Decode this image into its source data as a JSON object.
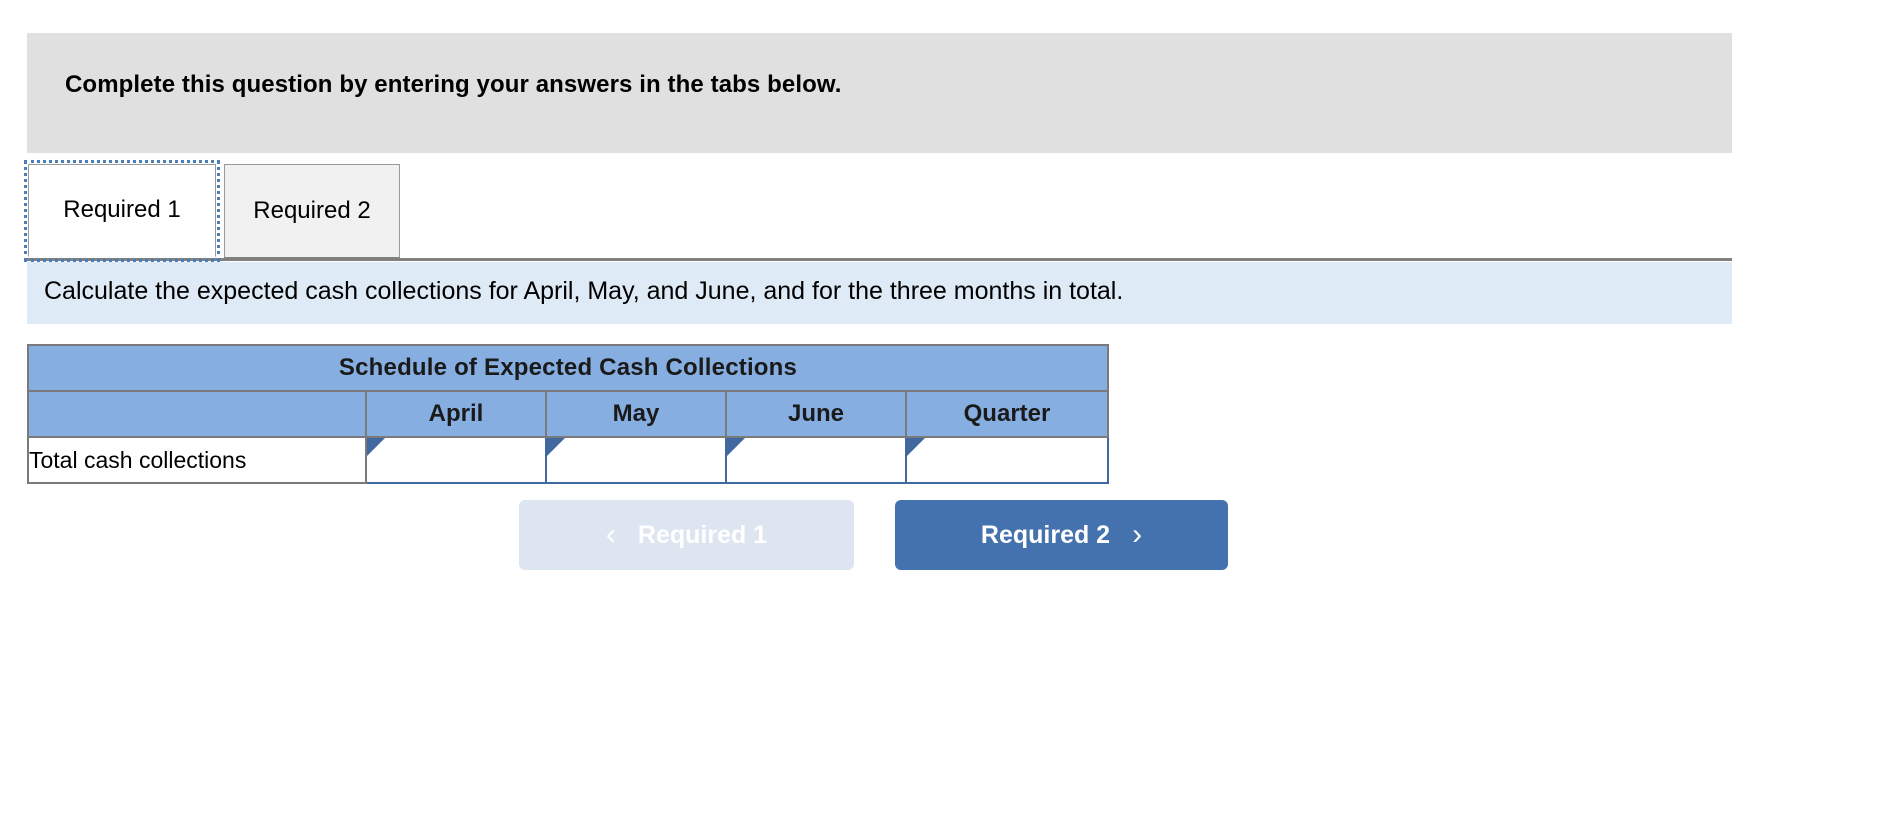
{
  "banner": {
    "text": "Complete this question by entering your answers in the tabs below."
  },
  "tabs": [
    {
      "label": "Required 1",
      "state": "active"
    },
    {
      "label": "Required 2",
      "state": "inactive"
    }
  ],
  "requirement": {
    "text": "Calculate the expected cash collections for April, May, and June, and for the three months in total."
  },
  "table": {
    "title": "Schedule of Expected Cash Collections",
    "corner_header": "",
    "columns": [
      "April",
      "May",
      "June",
      "Quarter"
    ],
    "rows": [
      {
        "label": "Total cash collections",
        "values": [
          "",
          "",
          "",
          ""
        ]
      }
    ]
  },
  "nav": {
    "prev_label": "Required 1",
    "prev_icon": "chevron-left-icon",
    "prev_chevron": "‹",
    "prev_disabled": true,
    "next_label": "Required 2",
    "next_icon": "chevron-right-icon",
    "next_chevron": "›"
  },
  "colors": {
    "banner_bg": "#e0e0e0",
    "requirement_bg": "#deeaf6",
    "table_header_bg": "#86aee0",
    "input_border": "#41699f",
    "nav_next_bg": "#4372ae",
    "nav_prev_bg": "#dde5f1",
    "focus_ring": "#4a7ebb"
  }
}
